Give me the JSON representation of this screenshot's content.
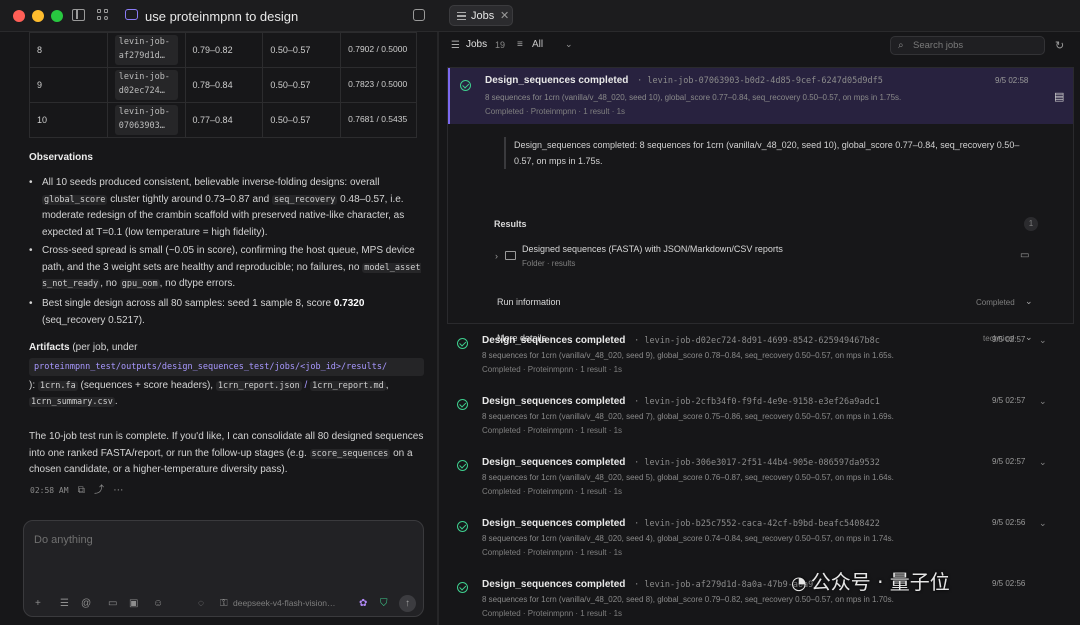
{
  "window": {
    "tab_title": "use proteinmpnn to design",
    "panel_tab": "Jobs",
    "panel_tab_close": "✕"
  },
  "colors": {
    "accent": "#8b7cf6",
    "success": "#3ecf8e",
    "selected_bg": "#28223f"
  },
  "results_table": {
    "rows": [
      {
        "seed": "8",
        "job": "levin-job-af279d1d…",
        "score": "0.79–0.82",
        "recovery": "0.50–0.57",
        "best": "0.7902 / 0.5000"
      },
      {
        "seed": "9",
        "job": "levin-job-d02ec724…",
        "score": "0.78–0.84",
        "recovery": "0.50–0.57",
        "best": "0.7823 / 0.5000"
      },
      {
        "seed": "10",
        "job": "levin-job-07063903…",
        "score": "0.77–0.84",
        "recovery": "0.50–0.57",
        "best": "0.7681 / 0.5435"
      }
    ]
  },
  "observations": {
    "title": "Observations",
    "b1_pre": "All 10 seeds produced consistent, believable inverse-folding designs: overall ",
    "b1_code1": "global_score",
    "b1_mid": " cluster tightly around 0.73–0.87 and ",
    "b1_code2": "seq_recovery",
    "b1_post": " 0.48–0.57, i.e. moderate redesign of the crambin scaffold with preserved native-like character, as expected at T=0.1 (low temperature = high fidelity).",
    "b2_pre": "Cross-seed spread is small (~0.05 in score), confirming the host queue, MPS device path, and the 3 weight sets are healthy and reproducible; no failures, no ",
    "b2_code1": "model_assets_not_ready",
    "b2_mid": ", no ",
    "b2_code2": "gpu_oom",
    "b2_post": ", no dtype errors.",
    "b3_pre": "Best single design across all 80 samples: seed 1 sample 8, score ",
    "b3_bold": "0.7320",
    "b3_post": " (seq_recovery 0.5217)."
  },
  "artifacts": {
    "title": "Artifacts",
    "under": " (per job, under",
    "path": "proteinmpnn_test/outputs/design_sequences_test/jobs/<job_id>/results/",
    "colon": "):",
    "f1": "1crn.fa",
    "f1_note": " (sequences + score headers), ",
    "f2": "1crn_report.json",
    "slash": " / ",
    "f3": "1crn_report.md",
    "comma": ", ",
    "f4": "1crn_summary.csv",
    "end": "."
  },
  "closing": {
    "pre": "The 10-job test run is complete. If you'd like, I can consolidate all 80 designed sequences into one ranked FASTA/report, or run the follow-up stages (e.g. ",
    "code": "score_sequences",
    "post": " on a chosen candidate, or a higher-temperature diversity pass)."
  },
  "message_meta": {
    "time": "02:58 AM"
  },
  "composer": {
    "placeholder": "Do anything",
    "model": "deepseek-v4-flash-vision…"
  },
  "jobs_panel": {
    "label": "Jobs",
    "count": "19",
    "filter": "All",
    "search_placeholder": "Search jobs"
  },
  "expanded_job": {
    "title": "Design_sequences completed",
    "id": "levin-job-07063903-b0d2-4d85-9cef-6247d05d9df5",
    "detail": "8 sequences for 1crn (vanilla/v_48_020, seed 10), global_score 0.77–0.84, seq_recovery 0.50–0.57, on mps in 1.75s.",
    "status": "Completed · Proteinmpnn · 1 result · 1s",
    "time": "9/5 02:58",
    "summary": "Design_sequences completed: 8 sequences for 1crn (vanilla/v_48_020, seed 10), global_score 0.77–0.84, seq_recovery 0.50–0.57, on mps in 1.75s.",
    "results_label": "Results",
    "results_count": "1",
    "result_name": "Designed sequences (FASTA) with JSON/Markdown/CSV reports",
    "result_sub": "Folder · results",
    "run_info_label": "Run information",
    "run_info_value": "Completed",
    "more_label": "More details",
    "more_value": "technical"
  },
  "jobs": [
    {
      "title": "Design_sequences completed",
      "id": "levin-job-d02ec724-8d91-4699-8542-625949467b8c",
      "detail": "8 sequences for 1crn (vanilla/v_48_020, seed 9), global_score 0.78–0.84, seq_recovery 0.50–0.57, on mps in 1.65s.",
      "status": "Completed · Proteinmpnn · 1 result · 1s",
      "time": "9/5 02:57"
    },
    {
      "title": "Design_sequences completed",
      "id": "levin-job-2cfb34f0-f9fd-4e9e-9158-e3ef26a9adc1",
      "detail": "8 sequences for 1crn (vanilla/v_48_020, seed 7), global_score 0.75–0.86, seq_recovery 0.50–0.57, on mps in 1.69s.",
      "status": "Completed · Proteinmpnn · 1 result · 1s",
      "time": "9/5 02:57"
    },
    {
      "title": "Design_sequences completed",
      "id": "levin-job-306e3017-2f51-44b4-905e-086597da9532",
      "detail": "8 sequences for 1crn (vanilla/v_48_020, seed 5), global_score 0.76–0.87, seq_recovery 0.50–0.57, on mps in 1.64s.",
      "status": "Completed · Proteinmpnn · 1 result · 1s",
      "time": "9/5 02:57"
    },
    {
      "title": "Design_sequences completed",
      "id": "levin-job-b25c7552-caca-42cf-b9bd-beafc5408422",
      "detail": "8 sequences for 1crn (vanilla/v_48_020, seed 4), global_score 0.74–0.84, seq_recovery 0.50–0.57, on mps in 1.74s.",
      "status": "Completed · Proteinmpnn · 1 result · 1s",
      "time": "9/5 02:56"
    },
    {
      "title": "Design_sequences completed",
      "id": "levin-job-af279d1d-8a0a-47b9-a6a9",
      "detail": "8 sequences for 1crn (vanilla/v_48_020, seed 8), global_score 0.79–0.82, seq_recovery 0.50–0.57, on mps in 1.70s.",
      "status": "Completed · Proteinmpnn · 1 result · 1s",
      "time": "9/5 02:56"
    }
  ],
  "watermark": "公众号 · 量子位"
}
